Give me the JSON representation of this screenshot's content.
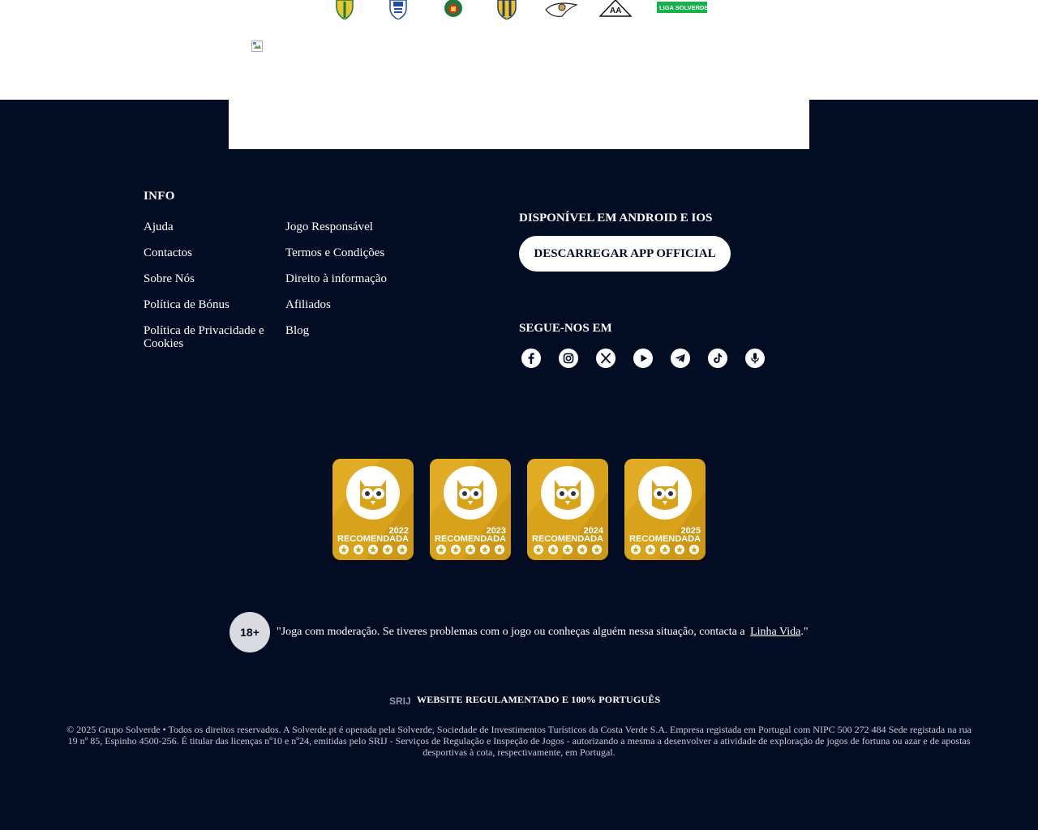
{
  "footer": {
    "info_title": "INFO",
    "links_col1": [
      "Ajuda",
      "Contactos",
      "Sobre Nós",
      "Política de Bónus",
      "Política de Privacidade e Cookies"
    ],
    "links_col2": [
      "Jogo Responsável",
      "Termos e Condições",
      "Direito à informação",
      "Afiliados",
      "Blog"
    ]
  },
  "app": {
    "title": "DISPONÍVEL EM ANDROID E IOS",
    "button_label": "DESCARREGAR APP OFFICIAL"
  },
  "social": {
    "title": "SEGUE-NOS EM",
    "icons": [
      "facebook-icon",
      "instagram-icon",
      "x-icon",
      "youtube-icon",
      "telegram-icon",
      "tiktok-icon",
      "microphone-icon"
    ]
  },
  "awards": [
    {
      "year": "2022",
      "label": "RECOMENDADA"
    },
    {
      "year": "2023",
      "label": "RECOMENDADA"
    },
    {
      "year": "2024",
      "label": "RECOMENDADA"
    },
    {
      "year": "2025",
      "label": "RECOMENDADA"
    }
  ],
  "responsible": {
    "age": "18+",
    "text_before": "\"Joga com moderação. Se tiveres problemas com o jogo ou conheças alguém nessa situação, contacta a",
    "link_text": "Linha Vida",
    "text_after": ".\""
  },
  "regulated": {
    "srij_logo": "SRIJ",
    "text": "WEBSITE REGULAMENTADO E 100% PORTUGUÊS"
  },
  "partners": {
    "liga_logo": "LIGA SOLVERDE"
  },
  "legal": "© 2025 Grupo Solverde • Todos os direitos reservados. A Solverde.pt é operada pela Solverde, Sociedade de Investimentos Turísticos da Costa Verde S.A. Empresa registada em Portugal com NIPC 500 272 484 Sede registada na rua 19 nº 85, Espinho 4500-256. É titular das licenças nº10 e nº24, emitidas pelo SRIJ - Serviços de Regulação e Inspeção de Jogos - autorizando a mesma a desenvolver a atividade de exploração de jogos de fortuna ou azar e de apostas desportivas à cota, respectivamente, em Portugal.",
  "colors": {
    "background": "#020d24",
    "gold": "#d9a21b",
    "white": "#ffffff"
  }
}
